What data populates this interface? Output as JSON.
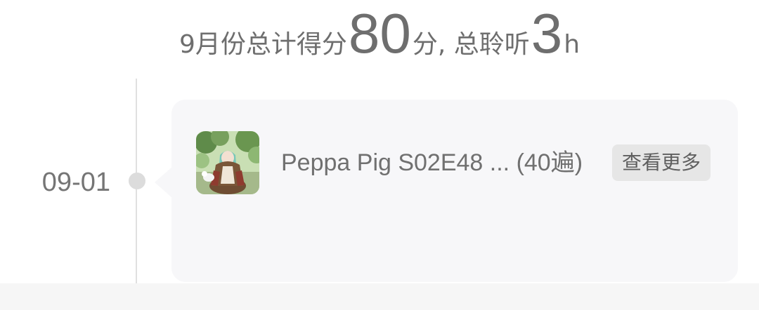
{
  "summary": {
    "prefix": "9月份总计得分",
    "score": "80",
    "middle": "分, 总聆听",
    "hours": "3",
    "suffix": "h"
  },
  "timeline": {
    "entries": [
      {
        "date": "09-01",
        "cover_icon": "album-cover-anime-girl",
        "title": "Peppa Pig S02E48 ... (40遍)",
        "more_label": "查看更多"
      }
    ]
  },
  "colors": {
    "text": "#6e6e6e",
    "card_bg": "#f7f7f9",
    "button_bg": "#e6e6e6",
    "timeline": "#e0e0e0"
  }
}
